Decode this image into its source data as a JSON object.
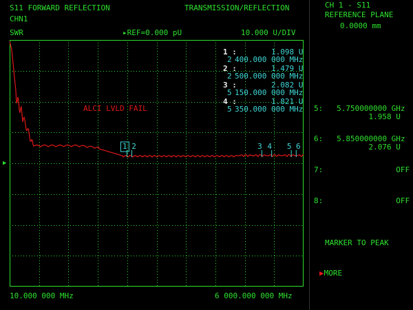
{
  "header": {
    "title": "S11 FORWARD REFLECTION",
    "channel": "CHN1",
    "mode": "TRANSMISSION/REFLECTION",
    "format": "SWR",
    "ref": "REF=0.000 pU",
    "scale": "10.000 U/DIV"
  },
  "footer": {
    "start_freq": "10.000 000 MHz",
    "stop_freq": "6 000.000 000 MHz"
  },
  "status": {
    "alc_message": "ALCI LVLD FAIL"
  },
  "marker_readouts": [
    {
      "num": "1 :",
      "value": "1.098 U",
      "sub": "2",
      "freq": "400.000 000 MHz"
    },
    {
      "num": "2 :",
      "value": "1.479 U",
      "sub": "2",
      "freq": "500.000 000 MHz"
    },
    {
      "num": "3 :",
      "value": "2.082 U",
      "sub": "5",
      "freq": "150.000 000 MHz"
    },
    {
      "num": "4 :",
      "value": "1.821 U",
      "sub": "5",
      "freq": "350.000 000 MHz"
    }
  ],
  "trace_markers": [
    {
      "label": "1",
      "freq_mhz": 2400
    },
    {
      "label": "2",
      "freq_mhz": 2500
    },
    {
      "label": "3",
      "freq_mhz": 5150
    },
    {
      "label": "4",
      "freq_mhz": 5350
    },
    {
      "label": "5",
      "freq_mhz": 5750
    },
    {
      "label": "6",
      "freq_mhz": 5850
    }
  ],
  "softkeys": {
    "header_line1": "CH 1 - S11",
    "header_line2": "REFERENCE PLANE",
    "header_line3": "0.0000 mm",
    "m5_label": "5:",
    "m5_freq": "5.750000000 GHz",
    "m5_value": "1.958 U",
    "m6_label": "6:",
    "m6_freq": "5.850000000 GHz",
    "m6_value": "2.076 U",
    "m7_label": "7:",
    "m7_value": "OFF",
    "m8_label": "8:",
    "m8_value": "OFF",
    "marker_to_peak": "MARKER TO PEAK",
    "more": "MORE"
  },
  "colors": {
    "graticule": "#2ee02e",
    "trace": "#e01818",
    "text": "#2ee02e",
    "marker_text": "#3fd6d6",
    "marker_num": "#f0f0f0"
  }
}
